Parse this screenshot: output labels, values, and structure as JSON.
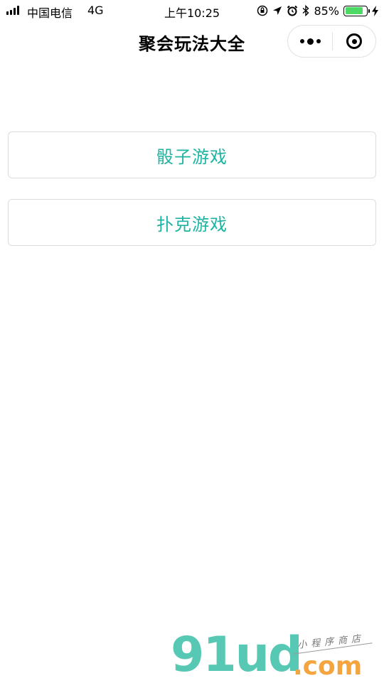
{
  "status_bar": {
    "carrier": "中国电信",
    "network": "4G",
    "time": "上午10:25",
    "battery_percent": "85%",
    "battery_level": 0.85,
    "icons": [
      "orientation-lock-icon",
      "location-icon",
      "alarm-icon",
      "bluetooth-icon",
      "battery-icon",
      "charging-icon"
    ]
  },
  "nav": {
    "title": "聚会玩法大全"
  },
  "menu": {
    "dice_label": "骰子游戏",
    "poker_label": "扑克游戏"
  },
  "colors": {
    "accent": "#1fb3a2",
    "battery": "#4cd964",
    "watermark_main": "#56c8b4",
    "watermark_sub": "#f4a540"
  },
  "watermark": {
    "brand": "91ud",
    "domain": ".com",
    "tagline": "小程序商店"
  }
}
